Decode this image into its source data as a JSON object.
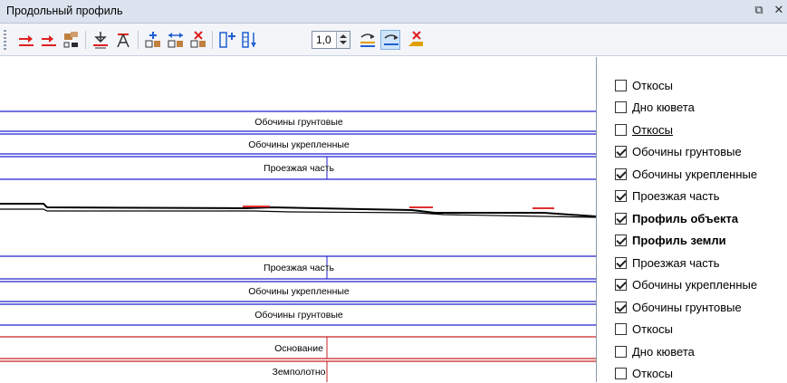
{
  "window": {
    "title": "Продольный профиль",
    "buttons": [
      {
        "name": "float-icon",
        "glyph": "⧉"
      },
      {
        "name": "close-icon",
        "glyph": "✕"
      }
    ]
  },
  "toolbar": {
    "icons": [
      "add-arrow-icon",
      "add-arrow-alt-icon",
      "move-block-icon",
      "point-up-icon",
      "point-text-icon",
      "add-element-icon",
      "stretch-element-icon",
      "delete-element-icon",
      "add-row-icon",
      "split-row-icon",
      "layer-visibility-icon",
      "layer-active-icon",
      "erase-layer-icon"
    ],
    "scale_value": "1,0",
    "active_icon": "layer-active-icon"
  },
  "canvas": {
    "bands": [
      {
        "label": "Обочины грунтовые",
        "color": "#2020d0"
      },
      {
        "label": "Обочины укрепленные",
        "color": "#2020d0"
      },
      {
        "label": "Проезжая часть",
        "color": "#2020d0"
      },
      {
        "label": "Проезжая часть",
        "color": "#2020d0"
      },
      {
        "label": "Обочины укрепленные",
        "color": "#2020d0"
      },
      {
        "label": "Обочины грунтовые",
        "color": "#2020d0"
      },
      {
        "label": "Основание",
        "color": "#c82020"
      },
      {
        "label": "Земполотно",
        "color": "#c82020"
      }
    ],
    "profile_color": "#000000",
    "profile_accent_color": "#e03030"
  },
  "layers": [
    {
      "label": "Откосы",
      "checked": false,
      "bold": false,
      "underline": false
    },
    {
      "label": "Дно кювета",
      "checked": false,
      "bold": false,
      "underline": false
    },
    {
      "label": "Откосы",
      "checked": false,
      "bold": false,
      "underline": true
    },
    {
      "label": "Обочины грунтовые",
      "checked": true,
      "bold": false,
      "underline": false
    },
    {
      "label": "Обочины укрепленные",
      "checked": true,
      "bold": false,
      "underline": false
    },
    {
      "label": "Проезжая часть",
      "checked": true,
      "bold": false,
      "underline": false
    },
    {
      "label": "Профиль объекта",
      "checked": true,
      "bold": true,
      "underline": false
    },
    {
      "label": "Профиль земли",
      "checked": true,
      "bold": true,
      "underline": false
    },
    {
      "label": "Проезжая часть",
      "checked": true,
      "bold": false,
      "underline": false
    },
    {
      "label": "Обочины укрепленные",
      "checked": true,
      "bold": false,
      "underline": false
    },
    {
      "label": "Обочины грунтовые",
      "checked": true,
      "bold": false,
      "underline": false
    },
    {
      "label": "Откосы",
      "checked": false,
      "bold": false,
      "underline": false
    },
    {
      "label": "Дно кювета",
      "checked": false,
      "bold": false,
      "underline": false
    },
    {
      "label": "Откосы",
      "checked": false,
      "bold": false,
      "underline": false
    }
  ]
}
